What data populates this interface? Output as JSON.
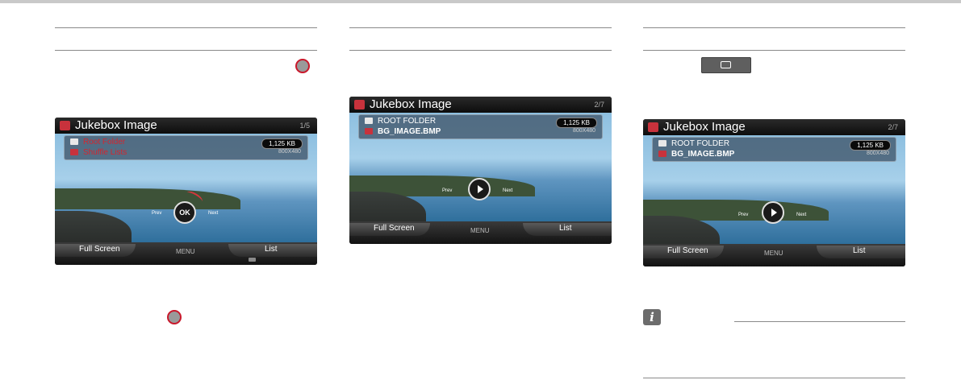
{
  "screens": [
    {
      "title": "Jukebox Image",
      "page": "1/5",
      "row1": "Root Folder",
      "row2": "Shuffle Lists",
      "size": "1,125 KB",
      "resolution": "800X480",
      "center": "OK",
      "left_label": "Prev",
      "right_label": "Next",
      "full_screen": "Full Screen",
      "menu": "MENU",
      "list": "List"
    },
    {
      "title": "Jukebox Image",
      "page": "2/7",
      "row1": "ROOT FOLDER",
      "row2": "BG_IMAGE.BMP",
      "size": "1,125 KB",
      "resolution": "800X480",
      "left_label": "Prev",
      "right_label": "Next",
      "full_screen": "Full Screen",
      "menu": "MENU",
      "list": "List"
    },
    {
      "title": "Jukebox Image",
      "page": "2/7",
      "row1": "ROOT FOLDER",
      "row2": "BG_IMAGE.BMP",
      "size": "1,125 KB",
      "resolution": "800X480",
      "left_label": "Prev",
      "right_label": "Next",
      "full_screen": "Full Screen",
      "menu": "MENU",
      "list": "List"
    }
  ],
  "info_icon": "i",
  "accent_red": "#c9182b"
}
